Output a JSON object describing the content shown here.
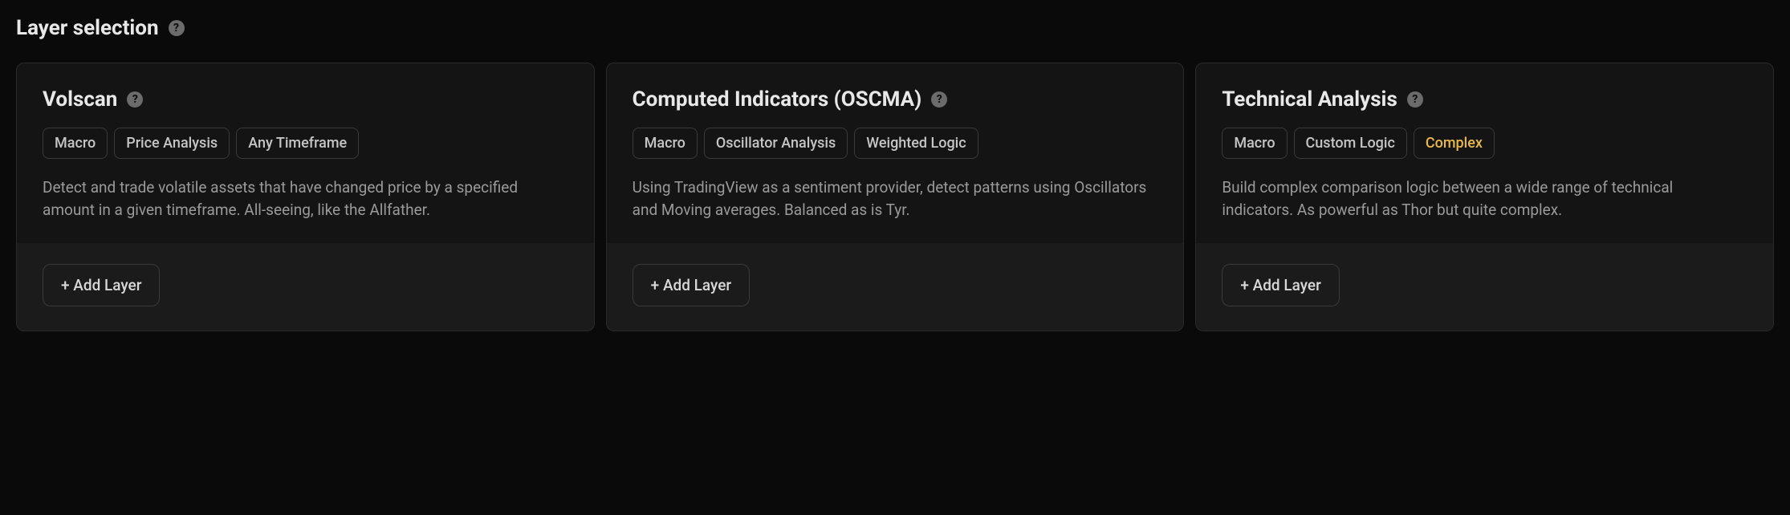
{
  "header": {
    "title": "Layer selection"
  },
  "addLayerLabel": "+ Add Layer",
  "cards": [
    {
      "id": "volscan",
      "title": "Volscan",
      "tags": [
        {
          "label": "Macro",
          "highlight": false
        },
        {
          "label": "Price Analysis",
          "highlight": false
        },
        {
          "label": "Any Timeframe",
          "highlight": false
        }
      ],
      "description": "Detect and trade volatile assets that have changed price by a specified amount in a given timeframe. All-seeing, like the Allfather."
    },
    {
      "id": "computed-indicators",
      "title": "Computed Indicators (OSCMA)",
      "tags": [
        {
          "label": "Macro",
          "highlight": false
        },
        {
          "label": "Oscillator Analysis",
          "highlight": false
        },
        {
          "label": "Weighted Logic",
          "highlight": false
        }
      ],
      "description": "Using TradingView as a sentiment provider, detect patterns using Oscillators and Moving averages. Balanced as is Tyr."
    },
    {
      "id": "technical-analysis",
      "title": "Technical Analysis",
      "tags": [
        {
          "label": "Macro",
          "highlight": false
        },
        {
          "label": "Custom Logic",
          "highlight": false
        },
        {
          "label": "Complex",
          "highlight": true
        }
      ],
      "description": "Build complex comparison logic between a wide range of technical indicators. As powerful as Thor but quite complex."
    }
  ]
}
